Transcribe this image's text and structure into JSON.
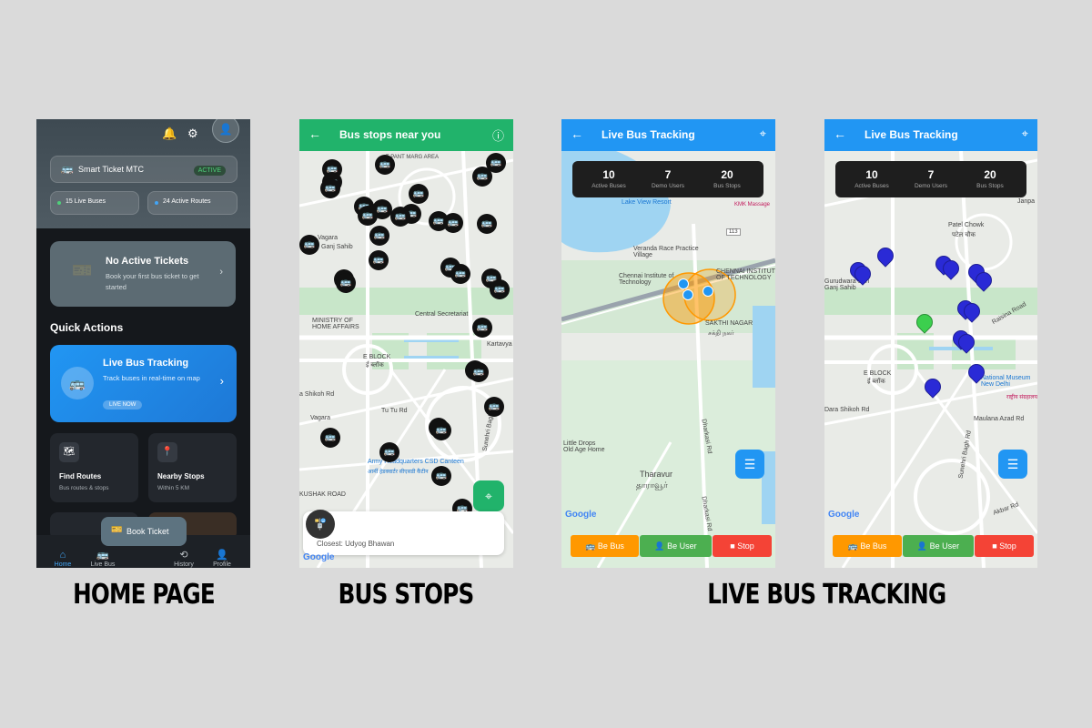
{
  "home": {
    "card_title": "Smart Ticket MTC",
    "card_badge": "ACTIVE",
    "live_buses": "15 Live Buses",
    "active_routes": "24 Active Routes",
    "no_tickets_title": "No Active Tickets",
    "no_tickets_sub": "Book your first bus ticket to get started",
    "quick_actions": "Quick Actions",
    "live_tracking_title": "Live Bus Tracking",
    "live_tracking_sub": "Track buses in real-time on map",
    "live_now": "LIVE NOW",
    "find_routes": "Find Routes",
    "find_routes_sub": "Bus routes & stops",
    "nearby_stops": "Nearby Stops",
    "nearby_stops_sub": "Within 5 KM",
    "book_ticket": "Book Ticket",
    "nav": [
      "Home",
      "Live Bus",
      "History",
      "Profile"
    ]
  },
  "bus_stops": {
    "title": "Bus stops near you",
    "closest": "Closest: Udyog Bhawan",
    "labels": {
      "ministry": "MINISTRY OF HOME AFFAIRS",
      "eblock": "E BLOCK",
      "eblock_local": "ई ब्लॉक",
      "central_sec": "Central Secretariat",
      "army": "Army Headquarters CSD Canteen",
      "army_local": "आर्मी हेडक्वार्टर सीएसडी कैंटीन",
      "kushak": "KUSHAK ROAD",
      "tutu": "Tu Tu Rd",
      "sunehri": "Sunehri Bagh Rd",
      "shikoh": "a Shikoh Rd",
      "vagara": "Vagara",
      "ganj": "Ganj Sahib",
      "tarpant": "T PANT MARG AREA",
      "kartavya": "Kartavya"
    }
  },
  "live1": {
    "title": "Live Bus Tracking",
    "stats": [
      {
        "num": "10",
        "label": "Active Buses"
      },
      {
        "num": "7",
        "label": "Demo Users"
      },
      {
        "num": "20",
        "label": "Bus Stops"
      }
    ],
    "labels": {
      "lakeview": "Lake View Resort",
      "veranda": "Veranda Race Practice Village",
      "chennai_inst": "Chennai Institute of Technology",
      "chennai_inst2": "CHENNAI INSTITUTE OF TECHNOLOGY",
      "sakthi": "SAKTHI NAGAR",
      "sakthi_local": "சக்தி நகர்",
      "little_drops": "Little Drops Old Age Home",
      "tharavur": "Tharavur",
      "tharavur_local": "தாராவூர்",
      "dharkasi": "Dharkasi Rd",
      "kmk": "KMK Massage",
      "road113": "113"
    },
    "buttons": [
      "Be Bus",
      "Be User",
      "Stop"
    ]
  },
  "live2": {
    "title": "Live Bus Tracking",
    "stats": [
      {
        "num": "10",
        "label": "Active Buses"
      },
      {
        "num": "7",
        "label": "Demo Users"
      },
      {
        "num": "20",
        "label": "Bus Stops"
      }
    ],
    "labels": {
      "patel": "Patel Chowk",
      "patel_local": "पटेल चौक",
      "ganj": "Gurudwara Shri Ganj Sahib",
      "eblock": "E BLOCK",
      "eblock_local": "ई ब्लॉक",
      "museum": "National Museum New Delhi",
      "museum_local": "राष्ट्रीय संग्रहालय",
      "shikoh": "Dara Shikoh Rd",
      "maulana": "Maulana Azad Rd",
      "sunehri": "Sunehri Bagh Rd",
      "akbar": "Akbar Rd",
      "raisina": "Raisina Road",
      "janpath": "Janpa"
    },
    "buttons": [
      "Be Bus",
      "Be User",
      "Stop"
    ]
  },
  "captions": [
    "HOME PAGE",
    "BUS STOPS",
    "LIVE BUS TRACKING"
  ],
  "google": "Google",
  "colors": {
    "green": "#21b36b",
    "blue": "#2196f3",
    "orange": "#ff9800",
    "user_green": "#4caf50",
    "stop_red": "#f44336"
  }
}
